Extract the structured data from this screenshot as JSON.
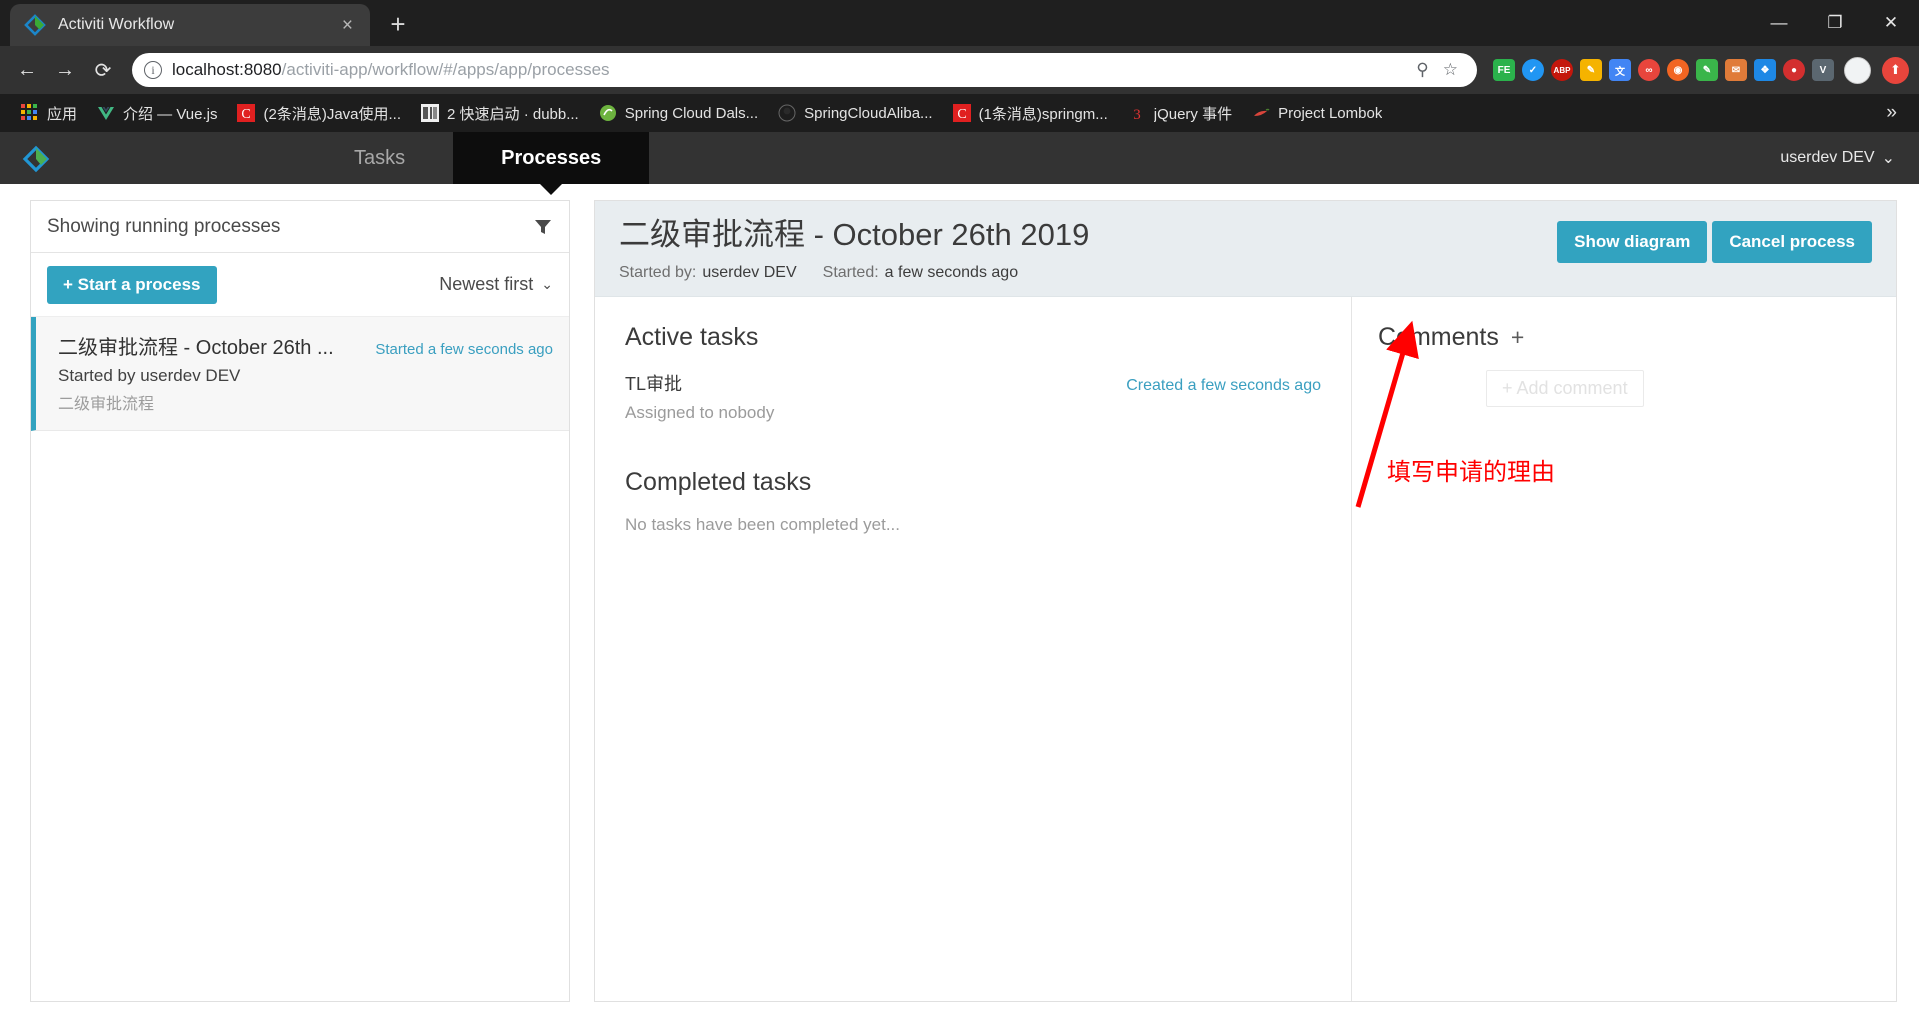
{
  "browser": {
    "tab": {
      "title": "Activiti Workflow",
      "favicon": "activiti-diamond-icon",
      "close": "×"
    },
    "newtab_label": "+",
    "window_controls": {
      "minimize": "—",
      "maximize": "❐",
      "close": "✕"
    },
    "nav": {
      "back": "←",
      "forward": "→",
      "reload": "⟳"
    },
    "omnibox": {
      "info_icon": "i",
      "url_host": "localhost:8080",
      "url_path": "/activiti-app/workflow/#/apps/app/processes",
      "search_icon": "⚲",
      "bookmark_icon": "☆"
    },
    "extensions": [
      {
        "name": "feedly-extension",
        "glyph": "FE",
        "color": "#2bb24c",
        "shape": "square"
      },
      {
        "name": "checkmark-extension",
        "glyph": "✓",
        "color": "#2196f3",
        "shape": "round"
      },
      {
        "name": "adblock-plus-extension",
        "glyph": "ABP",
        "color": "#c4170c",
        "shape": "round"
      },
      {
        "name": "notes-extension",
        "glyph": "✐",
        "color": "#f5b300",
        "shape": "square"
      },
      {
        "name": "google-translate-extension",
        "glyph": "文",
        "color": "#4285f4",
        "shape": "square"
      },
      {
        "name": "infinity-extension",
        "glyph": "∞",
        "color": "#e8453c",
        "shape": "round"
      },
      {
        "name": "honey-extension",
        "glyph": "◉",
        "color": "#f26522",
        "shape": "round"
      },
      {
        "name": "pen-extension",
        "glyph": "✒",
        "color": "#3ab54a",
        "shape": "square"
      },
      {
        "name": "mail-extension",
        "glyph": "✉",
        "color": "#e07b39",
        "shape": "square"
      },
      {
        "name": "puzzle-extension",
        "glyph": "❖",
        "color": "#1e88e5",
        "shape": "square"
      },
      {
        "name": "record-extension",
        "glyph": "●",
        "color": "#d32f2f",
        "shape": "round"
      },
      {
        "name": "vimeo-extension",
        "glyph": "V",
        "color": "#5b6770",
        "shape": "square"
      }
    ],
    "profile_avatar": "profile-avatar",
    "update_button": "⬆",
    "bookmarks": [
      {
        "label": "应用",
        "icon": "apps-grid-icon"
      },
      {
        "label": "介绍 — Vue.js",
        "icon": "vue-icon"
      },
      {
        "label": "(2条消息)Java使用...",
        "icon": "csdn-icon"
      },
      {
        "label": "2 快速启动 · dubb...",
        "icon": "dubbo-icon"
      },
      {
        "label": "Spring Cloud Dals...",
        "icon": "spring-icon"
      },
      {
        "label": "SpringCloudAliba...",
        "icon": "github-icon"
      },
      {
        "label": "(1条消息)springm...",
        "icon": "csdn-icon"
      },
      {
        "label": "jQuery 事件",
        "icon": "jquery-icon"
      },
      {
        "label": "Project Lombok",
        "icon": "lombok-icon"
      }
    ],
    "bookmarks_overflow": "»"
  },
  "app": {
    "logo": "activiti-logo-icon",
    "tabs": [
      {
        "label": "Tasks",
        "active": false
      },
      {
        "label": "Processes",
        "active": true
      }
    ],
    "user_menu": {
      "label": "userdev DEV",
      "chevron": "⌄"
    }
  },
  "left_panel": {
    "header_title": "Showing running processes",
    "filter_icon": "filter-funnel-icon",
    "start_button": "+ Start a process",
    "sort": {
      "label": "Newest first",
      "chevron": "⌄"
    },
    "processes": [
      {
        "name": "二级审批流程 - October 26th ...",
        "time": "Started a few seconds ago",
        "started_by": "Started by userdev DEV",
        "definition": "二级审批流程"
      }
    ]
  },
  "detail": {
    "title": "二级审批流程 - October 26th 2019",
    "meta": {
      "started_by_label": "Started by:",
      "started_by_value": "userdev DEV",
      "started_label": "Started:",
      "started_value": "a few seconds ago"
    },
    "buttons": {
      "show_diagram": "Show diagram",
      "cancel_process": "Cancel process"
    },
    "active_tasks": {
      "heading": "Active tasks",
      "items": [
        {
          "name": "TL审批",
          "assignee": "Assigned to nobody",
          "created": "Created a few seconds ago"
        }
      ]
    },
    "completed_tasks": {
      "heading": "Completed tasks",
      "empty": "No tasks have been completed yet..."
    },
    "comments": {
      "heading": "Comments",
      "add_icon": "+",
      "add_comment_placeholder": "+ Add comment"
    }
  },
  "annotation": {
    "text": "填写申请的理由",
    "color": "#ff0000",
    "arrow": "red-arrow-annotation"
  },
  "colors": {
    "accent_teal": "#32a3c0",
    "header_dark": "#333333",
    "tab_active_dark": "#0d0d0d",
    "detail_header_bg": "#e8edf0",
    "link_blue": "#3a9fc0",
    "annotation_red": "#ff0000"
  }
}
